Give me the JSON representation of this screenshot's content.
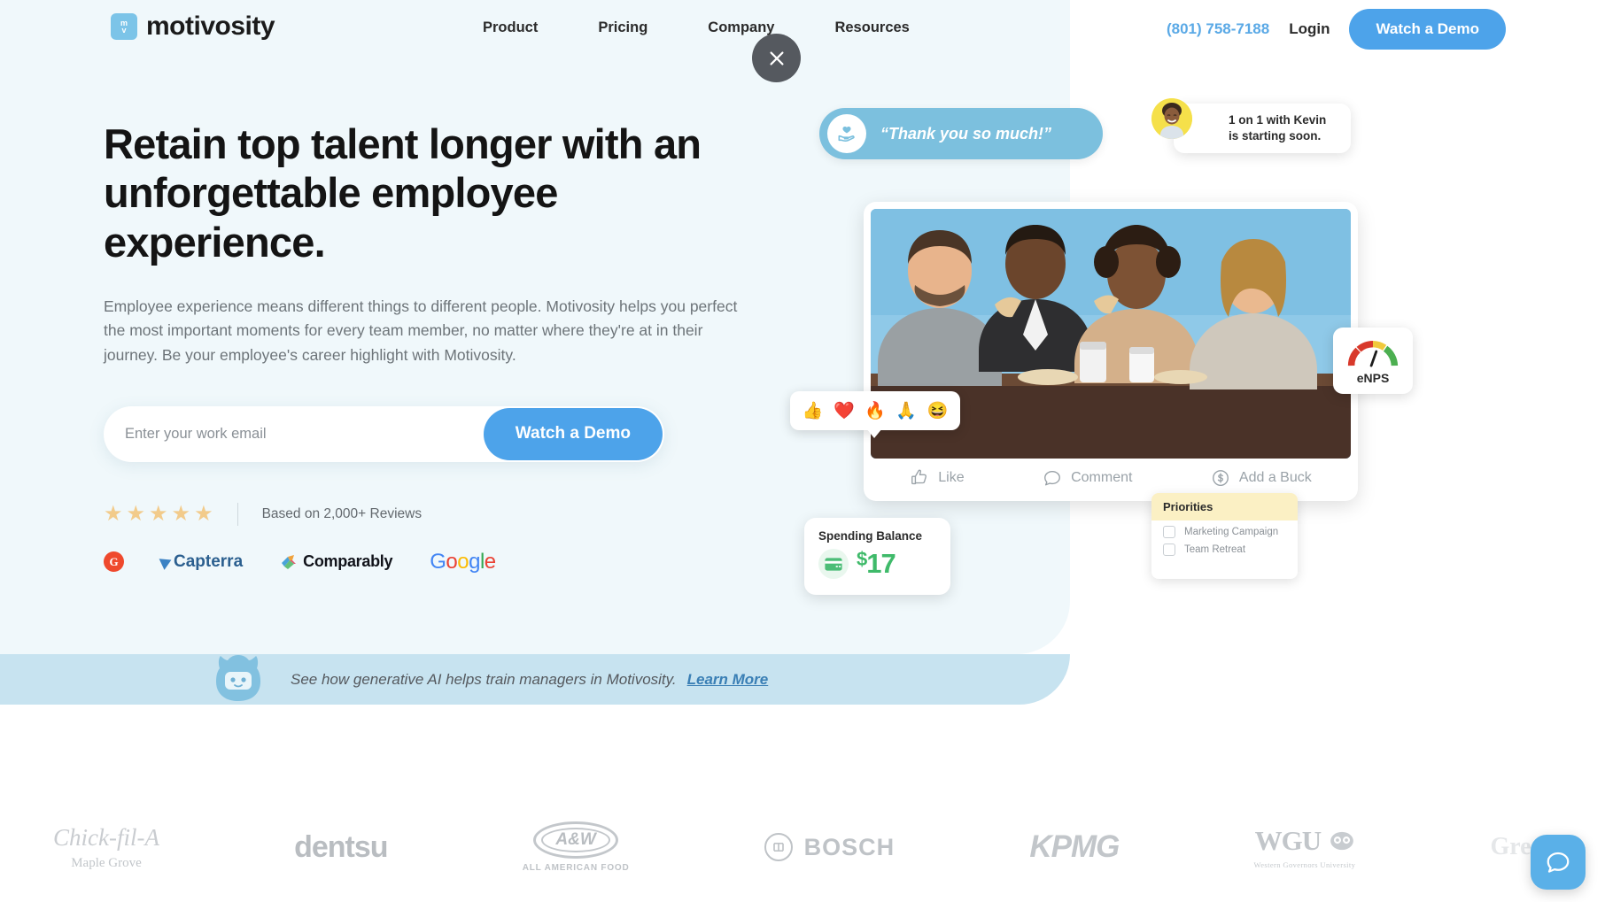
{
  "brand": {
    "name": "motivosity",
    "logo_mark_letters": "m v",
    "accent": "#4da3ea"
  },
  "header": {
    "nav": [
      {
        "label": "Product"
      },
      {
        "label": "Pricing"
      },
      {
        "label": "Company"
      },
      {
        "label": "Resources"
      }
    ],
    "phone": "(801) 758-7188",
    "login": "Login",
    "demo_button": "Watch a Demo",
    "close_icon": "close-icon"
  },
  "hero": {
    "headline": "Retain top talent longer with an unforgettable employee experience.",
    "subcopy": "Employee experience means different things to different people. Motivosity helps you perfect the most important moments for every team member, no matter where they're at in their journey. Be your employee's career highlight with Motivosity.",
    "email_placeholder": "Enter your work email",
    "email_value": "",
    "form_button": "Watch a Demo",
    "rating": {
      "stars": 5,
      "star_glyph": "★",
      "text": "Based on 2,000+ Reviews"
    },
    "review_logos": [
      {
        "name": "g2",
        "label": "G"
      },
      {
        "name": "capterra",
        "label": "Capterra"
      },
      {
        "name": "comparably",
        "label": "Comparably"
      },
      {
        "name": "google",
        "label": "Google"
      }
    ]
  },
  "ai_strip": {
    "text": "See how generative AI helps train managers in Motivosity.",
    "link": "Learn More",
    "icon": "ai-bot-icon"
  },
  "art": {
    "thanks_bubble": "“Thank you so much!”",
    "meeting_card_line1": "1 on 1 with Kevin",
    "meeting_card_line2": "is starting soon.",
    "reactions": [
      "👍",
      "❤️",
      "🔥",
      "🙏",
      "😆"
    ],
    "actions": [
      {
        "label": "Like",
        "icon": "thumbs-up-icon"
      },
      {
        "label": "Comment",
        "icon": "comment-icon"
      },
      {
        "label": "Add a Buck",
        "icon": "dollar-circle-icon"
      }
    ],
    "enps": {
      "label": "eNPS",
      "icon": "gauge-icon"
    },
    "spending": {
      "title": "Spending Balance",
      "currency": "$",
      "amount": "17",
      "icon": "credit-card-icon"
    },
    "priorities": {
      "title": "Priorities",
      "items": [
        {
          "label": "Marketing Campaign",
          "checked": false
        },
        {
          "label": "Team Retreat",
          "checked": false
        }
      ]
    }
  },
  "customer_logos": [
    {
      "name": "chick-fil-a",
      "label": "Chick-fil-A",
      "sub": "Maple Grove"
    },
    {
      "name": "dentsu",
      "label": "dentsu",
      "sub": ""
    },
    {
      "name": "a-and-w",
      "label": "A&W",
      "sub": "ALL AMERICAN FOOD"
    },
    {
      "name": "bosch",
      "label": "BOSCH",
      "sub": ""
    },
    {
      "name": "kpmg",
      "label": "KPMG",
      "sub": ""
    },
    {
      "name": "wgu",
      "label": "WGU",
      "sub": "Western Governors University"
    },
    {
      "name": "great-clips",
      "label": "Great",
      "sub": ""
    }
  ],
  "chat_widget": {
    "icon": "chat-bubble-icon"
  }
}
